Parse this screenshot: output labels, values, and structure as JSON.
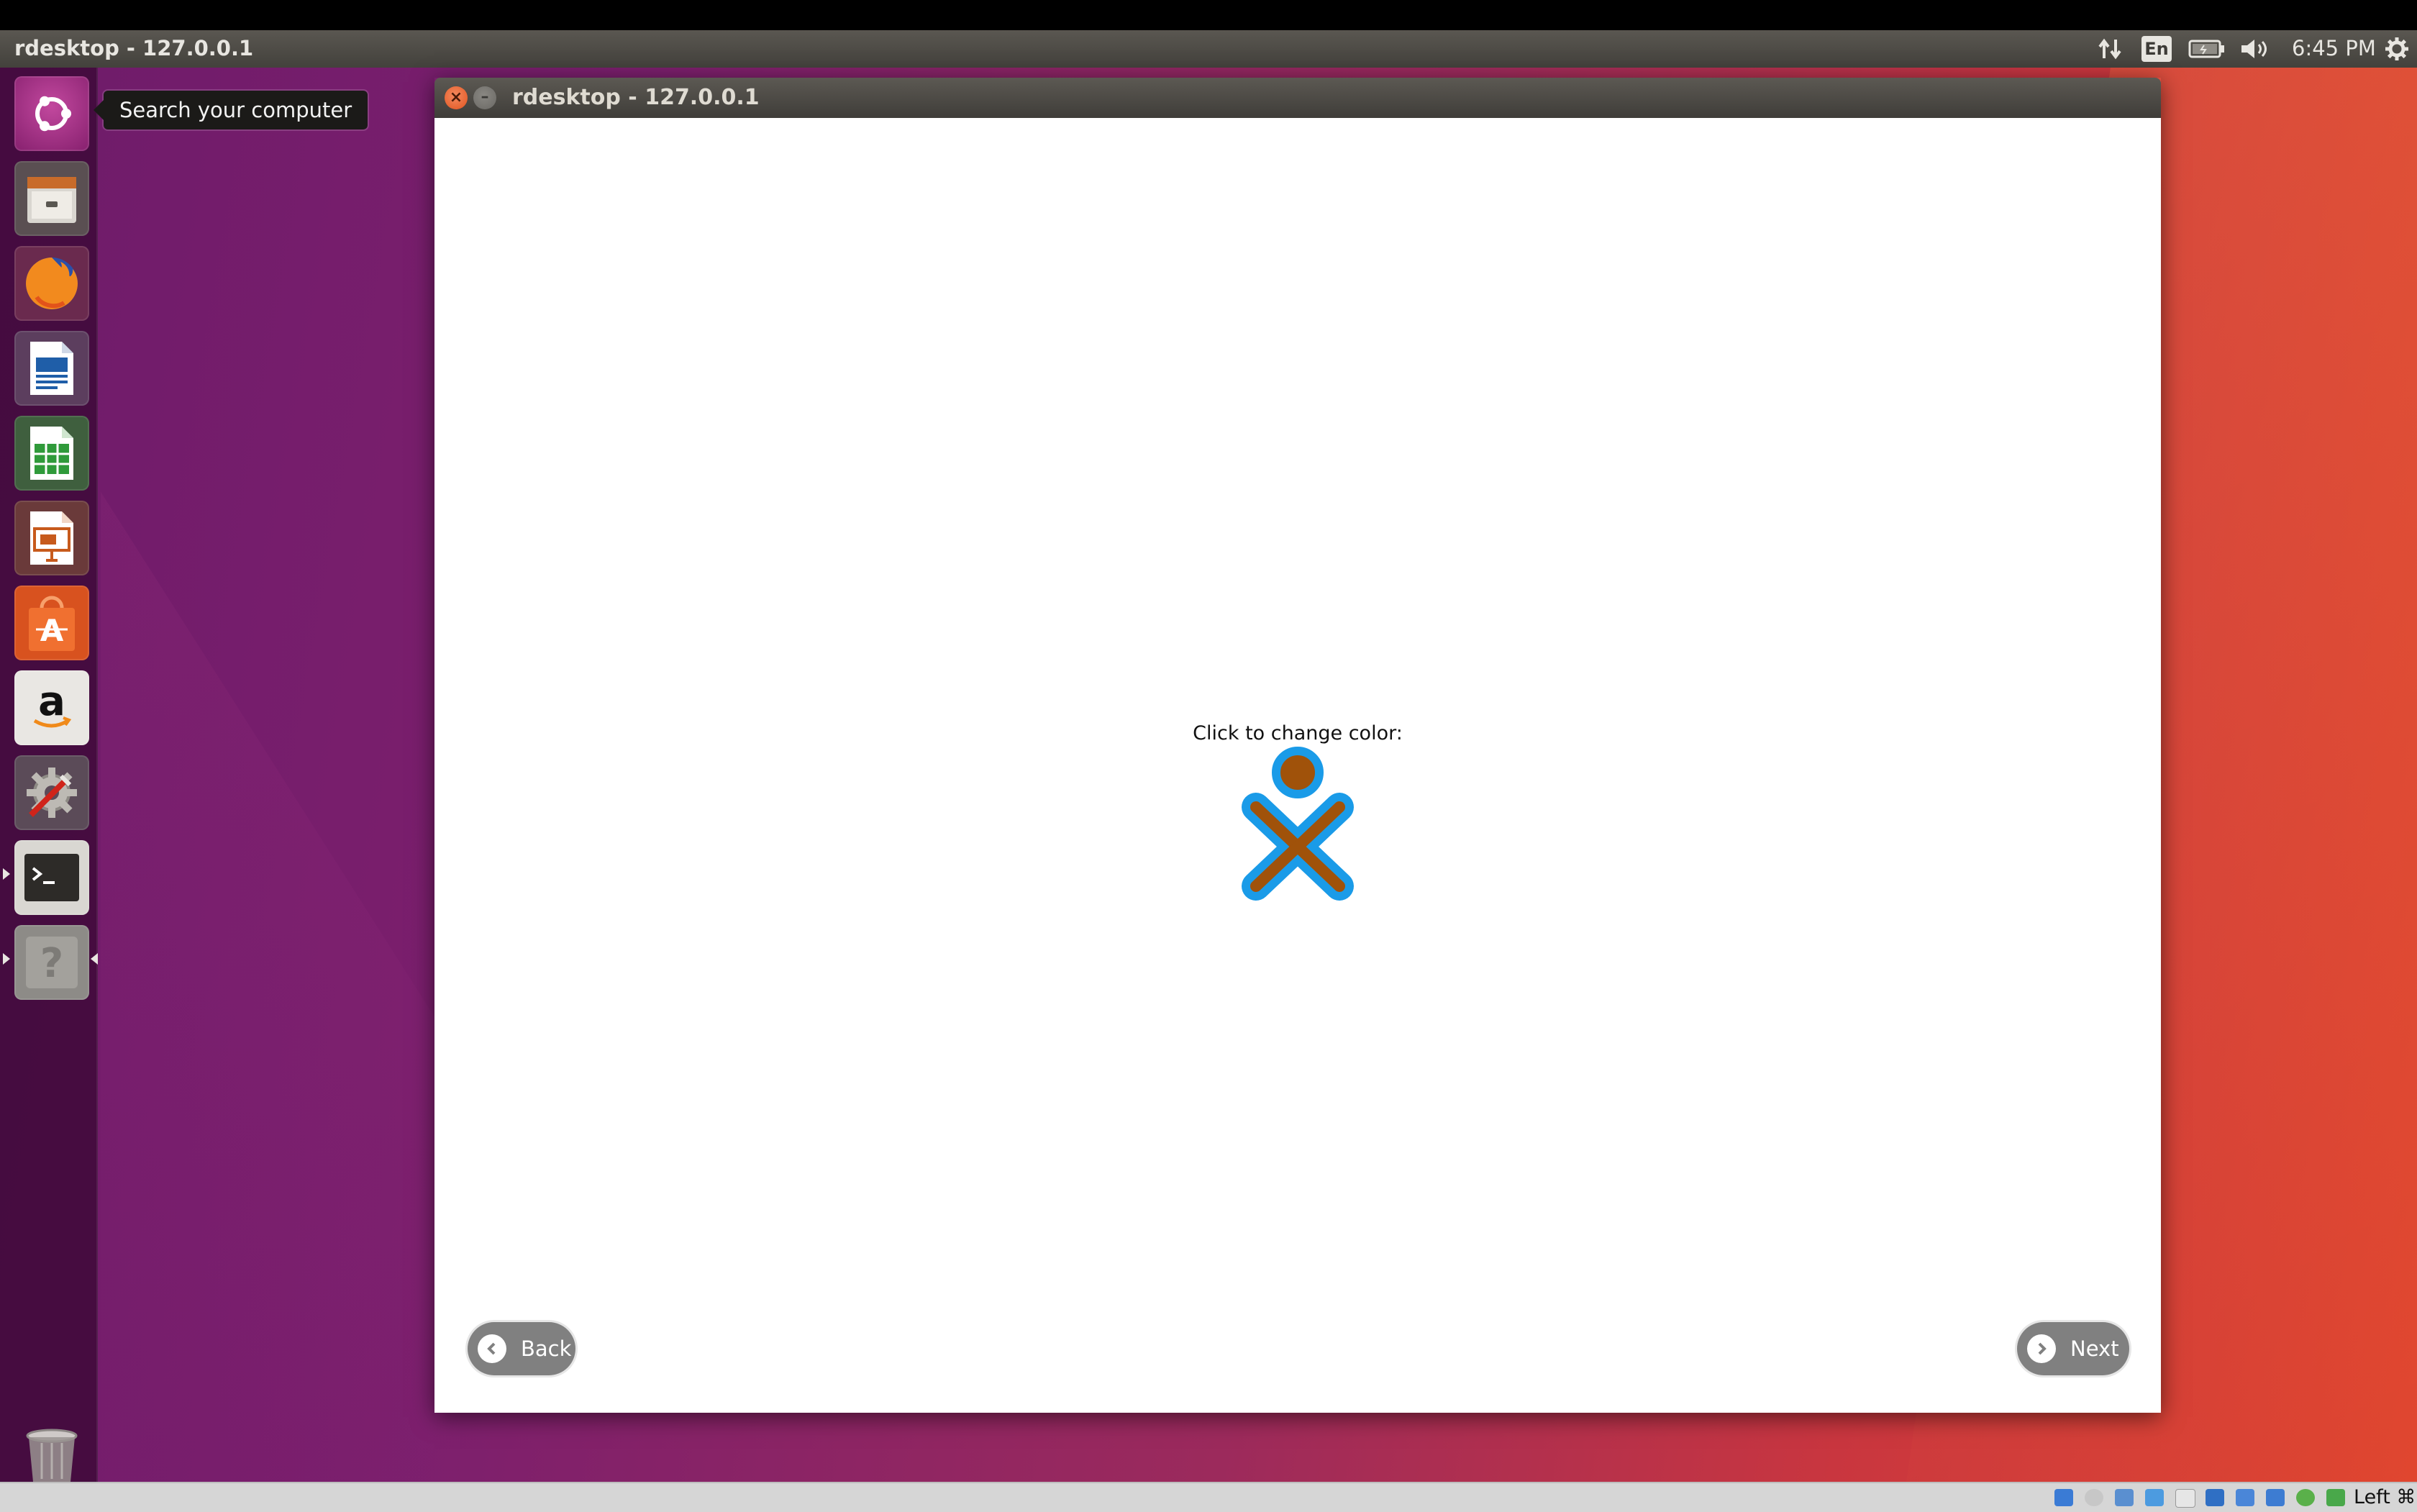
{
  "panel": {
    "app_title": "rdesktop - 127.0.0.1",
    "keyboard_layout": "En",
    "clock": "6:45 PM",
    "indicators": [
      "network-icon",
      "keyboard-icon",
      "battery-icon",
      "volume-icon",
      "settings-gear-icon"
    ]
  },
  "launcher": {
    "tooltip": "Search your computer",
    "items": [
      {
        "name": "dash-search",
        "icon": "ubuntu-logo-icon"
      },
      {
        "name": "files",
        "icon": "file-cabinet-icon"
      },
      {
        "name": "firefox",
        "icon": "firefox-icon"
      },
      {
        "name": "libreoffice-writer",
        "icon": "writer-icon"
      },
      {
        "name": "libreoffice-calc",
        "icon": "calc-icon"
      },
      {
        "name": "libreoffice-impress",
        "icon": "impress-icon"
      },
      {
        "name": "ubuntu-software",
        "icon": "shopping-bag-icon"
      },
      {
        "name": "amazon",
        "icon": "amazon-icon"
      },
      {
        "name": "system-settings",
        "icon": "settings-tools-icon"
      },
      {
        "name": "terminal",
        "icon": "terminal-icon"
      },
      {
        "name": "unknown-app",
        "icon": "question-mark-icon"
      }
    ],
    "trash_icon": "trash-icon"
  },
  "window": {
    "title": "rdesktop - 127.0.0.1",
    "prompt": "Click to change color:",
    "xo_colors": {
      "stroke": "#1a9be8",
      "fill": "#a0520a"
    },
    "back_label": "Back",
    "next_label": "Next"
  },
  "statusbar": {
    "host_key": "Left ⌘"
  }
}
